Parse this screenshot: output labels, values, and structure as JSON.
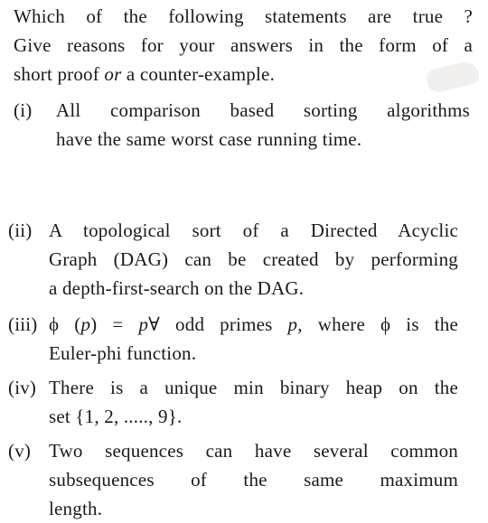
{
  "intro": {
    "lines": [
      "Which of the following statements are true ?",
      "Give reasons for your answers in the form of a",
      "short proof ",
      "or",
      " a counter-example."
    ]
  },
  "items": [
    {
      "number": "(i)",
      "lines": [
        "All comparison based sorting algorithms",
        "have the same worst case running time."
      ]
    },
    {
      "number": "(ii)",
      "lines": [
        "A topological sort of a Directed Acyclic",
        "Graph (DAG) can be created by performing",
        "a depth-first-search on the DAG."
      ]
    },
    {
      "number": "(iii)",
      "line1_parts": [
        "ϕ (",
        "p",
        ") = ",
        "p",
        "∀ odd primes ",
        "p",
        ", where ϕ is the"
      ],
      "lines": [
        "Euler-phi function."
      ]
    },
    {
      "number": "(iv)",
      "lines": [
        "There is a unique min binary heap on the",
        "set {1, 2, ....., 9}."
      ]
    },
    {
      "number": "(v)",
      "lines": [
        "Two sequences can have several common",
        "subsequences of the same maximum",
        "length."
      ]
    }
  ]
}
